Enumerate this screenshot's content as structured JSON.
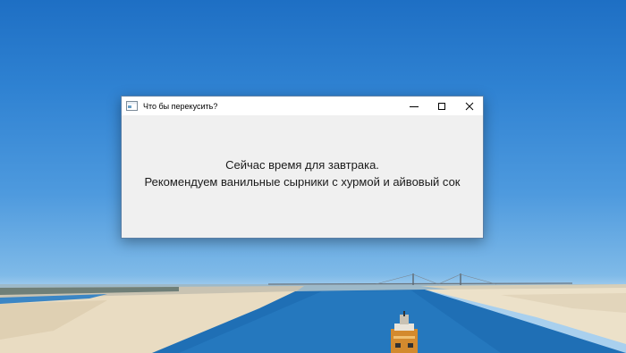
{
  "window": {
    "title": "Что бы перекусить?",
    "controls": {
      "minimize_icon": "minimize-icon",
      "maximize_icon": "maximize-icon",
      "close_icon": "close-icon"
    }
  },
  "message": {
    "line1": "Сейчас время для завтрака.",
    "line2": "Рекомендуем ванильные сырники с хурмой и айвовый сок"
  },
  "colors": {
    "sky": "#2f82d2",
    "water": "#1f6fb5",
    "sand": "#e9dcc2",
    "window_bg": "#f0f0f0",
    "titlebar_bg": "#ffffff"
  }
}
